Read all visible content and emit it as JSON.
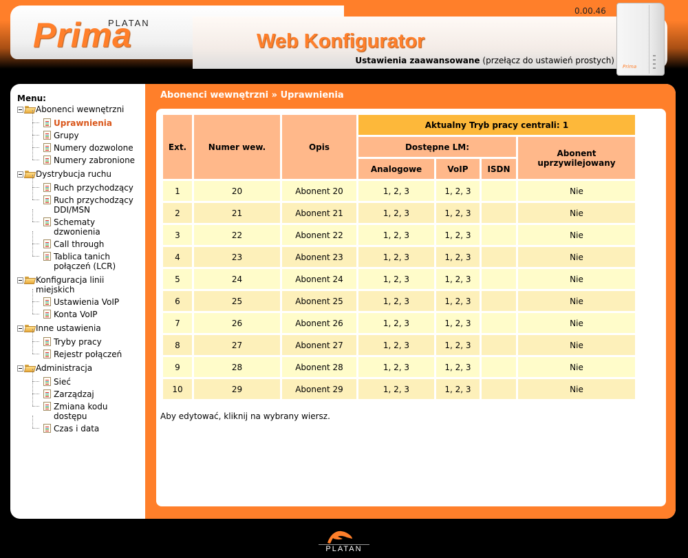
{
  "header": {
    "brand_small": "PLATAN",
    "brand": "Prima",
    "app_title": "Web Konfigurator",
    "version": "0.00.46",
    "mode_current": "Ustawienia zaawansowane",
    "mode_switch_link": "(przełącz do ustawień prostych)",
    "device_brand": "Prima"
  },
  "sidebar": {
    "title": "Menu:",
    "groups": [
      {
        "label": "Abonenci wewnętrzni",
        "items": [
          {
            "label": "Uprawnienia",
            "active": true
          },
          {
            "label": "Grupy"
          },
          {
            "label": "Numery dozwolone"
          },
          {
            "label": "Numery zabronione"
          }
        ]
      },
      {
        "label": "Dystrybucja ruchu",
        "items": [
          {
            "label": "Ruch przychodzący"
          },
          {
            "label": "Ruch przychodzący DDI/MSN"
          },
          {
            "label": "Schematy dzwonienia"
          },
          {
            "label": "Call through"
          },
          {
            "label": "Tablica tanich połączeń (LCR)"
          }
        ]
      },
      {
        "label": "Konfiguracja linii miejskich",
        "items": [
          {
            "label": "Ustawienia VoIP"
          },
          {
            "label": "Konta VoIP"
          }
        ]
      },
      {
        "label": "Inne ustawienia",
        "items": [
          {
            "label": "Tryby pracy"
          },
          {
            "label": "Rejestr połączeń"
          }
        ]
      },
      {
        "label": "Administracja",
        "items": [
          {
            "label": "Sieć"
          },
          {
            "label": "Zarządzaj"
          },
          {
            "label": "Zmiana kodu dostępu"
          },
          {
            "label": "Czas i data"
          }
        ]
      }
    ]
  },
  "main": {
    "breadcrumb": "Abonenci wewnętrzni » Uprawnienia",
    "table": {
      "mode_header": "Aktualny Tryb pracy centrali: 1",
      "headers": {
        "ext": "Ext.",
        "number": "Numer wew.",
        "desc": "Opis",
        "lm_group": "Dostępne LM:",
        "analog": "Analogowe",
        "voip": "VoIP",
        "isdn": "ISDN",
        "privileged": "Abonent uprzywilejowany"
      },
      "rows": [
        {
          "ext": "1",
          "number": "20",
          "desc": "Abonent 20",
          "analog": "1, 2, 3",
          "voip": "1, 2, 3",
          "isdn": "",
          "privileged": "Nie"
        },
        {
          "ext": "2",
          "number": "21",
          "desc": "Abonent 21",
          "analog": "1, 2, 3",
          "voip": "1, 2, 3",
          "isdn": "",
          "privileged": "Nie"
        },
        {
          "ext": "3",
          "number": "22",
          "desc": "Abonent 22",
          "analog": "1, 2, 3",
          "voip": "1, 2, 3",
          "isdn": "",
          "privileged": "Nie"
        },
        {
          "ext": "4",
          "number": "23",
          "desc": "Abonent 23",
          "analog": "1, 2, 3",
          "voip": "1, 2, 3",
          "isdn": "",
          "privileged": "Nie"
        },
        {
          "ext": "5",
          "number": "24",
          "desc": "Abonent 24",
          "analog": "1, 2, 3",
          "voip": "1, 2, 3",
          "isdn": "",
          "privileged": "Nie"
        },
        {
          "ext": "6",
          "number": "25",
          "desc": "Abonent 25",
          "analog": "1, 2, 3",
          "voip": "1, 2, 3",
          "isdn": "",
          "privileged": "Nie"
        },
        {
          "ext": "7",
          "number": "26",
          "desc": "Abonent 26",
          "analog": "1, 2, 3",
          "voip": "1, 2, 3",
          "isdn": "",
          "privileged": "Nie"
        },
        {
          "ext": "8",
          "number": "27",
          "desc": "Abonent 27",
          "analog": "1, 2, 3",
          "voip": "1, 2, 3",
          "isdn": "",
          "privileged": "Nie"
        },
        {
          "ext": "9",
          "number": "28",
          "desc": "Abonent 28",
          "analog": "1, 2, 3",
          "voip": "1, 2, 3",
          "isdn": "",
          "privileged": "Nie"
        },
        {
          "ext": "10",
          "number": "29",
          "desc": "Abonent 29",
          "analog": "1, 2, 3",
          "voip": "1, 2, 3",
          "isdn": "",
          "privileged": "Nie"
        }
      ]
    },
    "hint": "Aby edytować, kliknij na wybrany wiersz."
  },
  "footer": {
    "logo_text": "PLATAN"
  },
  "colors": {
    "accent": "#ff7f2a",
    "header_cell": "#ffb88a",
    "mode_cell": "#fdb83a",
    "row_odd": "#fffcca",
    "row_even": "#fdf0ba",
    "active_menu": "#d9561a"
  }
}
